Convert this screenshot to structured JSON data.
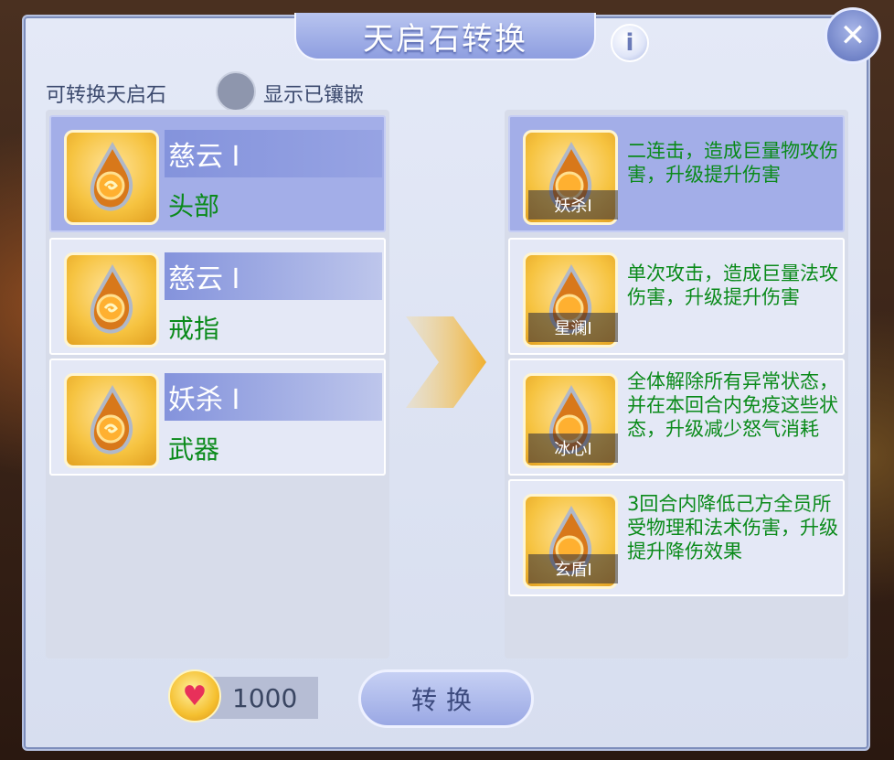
{
  "title": "天启石转换",
  "filter": {
    "label": "可转换天启石",
    "toggle_label": "显示已镶嵌"
  },
  "source_items": [
    {
      "name": "慈云 Ⅰ",
      "slot": "头部",
      "selected": true
    },
    {
      "name": "慈云 Ⅰ",
      "slot": "戒指",
      "selected": false
    },
    {
      "name": "妖杀 Ⅰ",
      "slot": "武器",
      "selected": false
    }
  ],
  "target_items": [
    {
      "caption": "妖杀Ⅰ",
      "desc": "二连击，造成巨量物攻伤害，升级提升伤害",
      "selected": true
    },
    {
      "caption": "星澜Ⅰ",
      "desc": "单次攻击，造成巨量法攻伤害，升级提升伤害",
      "selected": false
    },
    {
      "caption": "冰心Ⅰ",
      "desc": "全体解除所有异常状态，并在本回合内免疫这些状态，升级减少怒气消耗",
      "selected": false
    },
    {
      "caption": "玄盾Ⅰ",
      "desc": "3回合内降低己方全员所受物理和法术伤害，升级提升降伤效果",
      "selected": false
    }
  ],
  "currency": {
    "amount": "1000",
    "icon": "heart-coin-icon"
  },
  "convert_button": "转换",
  "colors": {
    "accent": "#8493dc",
    "desc_green": "#0a8a1a",
    "selected_bg": "#a3aee8"
  }
}
